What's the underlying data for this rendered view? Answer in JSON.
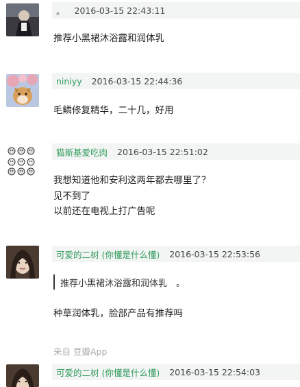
{
  "comments": [
    {
      "author": "。",
      "time": "2016-03-15 22:43:11",
      "lines": [
        "推荐小黑裙沐浴露和润体乳"
      ]
    },
    {
      "author": "niniyy",
      "time": "2016-03-15 22:44:36",
      "lines": [
        "毛鳞修复精华，二十几，好用"
      ]
    },
    {
      "author": "猫斯基爱吃肉",
      "time": "2016-03-15 22:51:02",
      "lines": [
        "我想知道他和安利这两年都去哪里了？",
        "见不到了",
        "以前还在电视上打广告呢"
      ]
    },
    {
      "author": "可爱的二树 (你懂是什么懂)",
      "time": "2016-03-15 22:53:56",
      "quote": "推荐小黑裙沐浴露和润体乳　。",
      "lines": [
        "种草润体乳，脸部产品有推荐吗"
      ],
      "source": "来自  豆瓣App"
    },
    {
      "author": "可爱的二树 (你懂是什么懂)",
      "time": "2016-03-15 22:54:03",
      "lines": []
    }
  ],
  "colors": {
    "author_green": "#2f9a5b",
    "header_bg": "#f2f5f3",
    "source_gray": "#aaaaaa"
  }
}
